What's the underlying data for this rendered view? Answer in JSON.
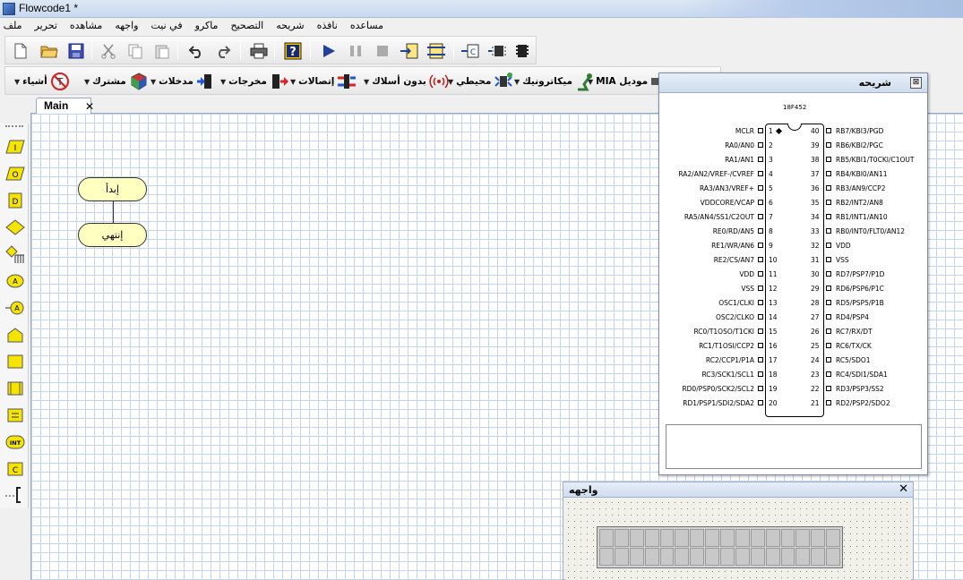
{
  "window": {
    "title": "Flowcode1 *"
  },
  "menu": [
    "ملف",
    "تحرير",
    "مشاهده",
    "واجهه",
    "في نيت",
    "ماكرو",
    "التصحيح",
    "شريحه",
    "نافذه",
    "مساعده"
  ],
  "toolbar1": {
    "buttons": [
      "new-file",
      "open-folder",
      "save",
      "cut",
      "copy",
      "paste",
      "undo",
      "redo",
      "print",
      "help",
      "run",
      "pause",
      "stop",
      "step-into",
      "step-over",
      "compile-c",
      "compile-hex",
      "chip-program"
    ]
  },
  "toolbar2": {
    "categories": [
      {
        "label": "أشياء",
        "icon": "tools-icon"
      },
      {
        "label": "مشترك",
        "icon": "cubes-icon"
      },
      {
        "label": "مدخلات",
        "icon": "input-icon"
      },
      {
        "label": "مخرجات",
        "icon": "output-icon"
      },
      {
        "label": "إتصالات",
        "icon": "comms-icon"
      },
      {
        "label": "بدون أسلاك",
        "icon": "wireless-icon"
      },
      {
        "label": "محيطي",
        "icon": "peripheral-icon"
      },
      {
        "label": "ميكاترونيك",
        "icon": "robot-arm-icon"
      },
      {
        "label": "موديل MIA",
        "icon": "mia-icon"
      }
    ]
  },
  "tabs": [
    {
      "label": "Main",
      "close": "✕"
    }
  ],
  "flowchart": {
    "start": "إبدأ",
    "end": "إنتهي"
  },
  "palette": [
    "I",
    "O",
    "D",
    "◇",
    "⊓",
    "A",
    "A",
    "⌂",
    "□",
    "⊡",
    "≡",
    "INT",
    "C",
    "["
  ],
  "chip_window": {
    "title": "شريحه",
    "close": "⊠",
    "chip_name": "18F452",
    "left_pins": [
      {
        "name": "MCLR",
        "num": "1"
      },
      {
        "name": "RA0/AN0",
        "num": "2"
      },
      {
        "name": "RA1/AN1",
        "num": "3"
      },
      {
        "name": "RA2/AN2/VREF-/CVREF",
        "num": "4"
      },
      {
        "name": "RA3/AN3/VREF+",
        "num": "5"
      },
      {
        "name": "VDDCORE/VCAP",
        "num": "6"
      },
      {
        "name": "RA5/AN4/SS1/C2OUT",
        "num": "7"
      },
      {
        "name": "RE0/RD/AN5",
        "num": "8"
      },
      {
        "name": "RE1/WR/AN6",
        "num": "9"
      },
      {
        "name": "RE2/CS/AN7",
        "num": "10"
      },
      {
        "name": "VDD",
        "num": "11"
      },
      {
        "name": "VSS",
        "num": "12"
      },
      {
        "name": "OSC1/CLKI",
        "num": "13"
      },
      {
        "name": "OSC2/CLKO",
        "num": "14"
      },
      {
        "name": "RC0/T1OSO/T1CKI",
        "num": "15"
      },
      {
        "name": "RC1/T1OSI/CCP2",
        "num": "16"
      },
      {
        "name": "RC2/CCP1/P1A",
        "num": "17"
      },
      {
        "name": "RC3/SCK1/SCL1",
        "num": "18"
      },
      {
        "name": "RD0/PSP0/SCK2/SCL2",
        "num": "19"
      },
      {
        "name": "RD1/PSP1/SDI2/SDA2",
        "num": "20"
      }
    ],
    "right_pins": [
      {
        "name": "RB7/KBI3/PGD",
        "num": "40"
      },
      {
        "name": "RB6/KBI2/PGC",
        "num": "39"
      },
      {
        "name": "RB5/KBI1/T0CKI/C1OUT",
        "num": "38"
      },
      {
        "name": "RB4/KBI0/AN11",
        "num": "37"
      },
      {
        "name": "RB3/AN9/CCP2",
        "num": "36"
      },
      {
        "name": "RB2/INT2/AN8",
        "num": "35"
      },
      {
        "name": "RB1/INT1/AN10",
        "num": "34"
      },
      {
        "name": "RB0/INT0/FLT0/AN12",
        "num": "33"
      },
      {
        "name": "VDD",
        "num": "32"
      },
      {
        "name": "VSS",
        "num": "31"
      },
      {
        "name": "RD7/PSP7/P1D",
        "num": "30"
      },
      {
        "name": "RD6/PSP6/P1C",
        "num": "29"
      },
      {
        "name": "RD5/PSP5/P1B",
        "num": "28"
      },
      {
        "name": "RD4/PSP4",
        "num": "27"
      },
      {
        "name": "RC7/RX/DT",
        "num": "26"
      },
      {
        "name": "RC6/TX/CK",
        "num": "25"
      },
      {
        "name": "RC5/SDO1",
        "num": "24"
      },
      {
        "name": "RC4/SDI1/SDA1",
        "num": "23"
      },
      {
        "name": "RD3/PSP3/SS2",
        "num": "22"
      },
      {
        "name": "RD2/PSP2/SDO2",
        "num": "21"
      }
    ]
  },
  "panel_window": {
    "title": "واجهه",
    "close": "✕"
  }
}
